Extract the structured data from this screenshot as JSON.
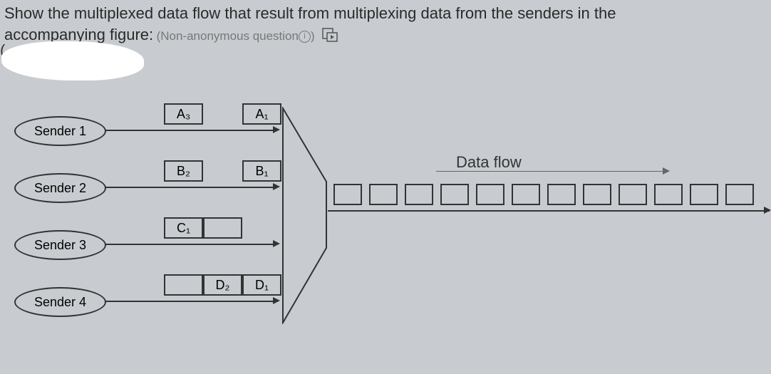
{
  "question": {
    "text_line1": "Show the multiplexed data flow that result from multiplexing data from the senders in the",
    "text_line2": "accompanying figure:",
    "hint": "(Non-anonymous question",
    "paren": "("
  },
  "diagram": {
    "senders": [
      {
        "label": "Sender 1",
        "packets": [
          "A₃",
          "",
          "A₁"
        ]
      },
      {
        "label": "Sender 2",
        "packets": [
          "B₂",
          "",
          "B₁"
        ]
      },
      {
        "label": "Sender 3",
        "packets": [
          "C₁",
          "",
          ""
        ]
      },
      {
        "label": "Sender 4",
        "packets": [
          "",
          "D₂",
          "D₁"
        ]
      }
    ],
    "output_label": "Data flow",
    "output_slots": 12
  }
}
